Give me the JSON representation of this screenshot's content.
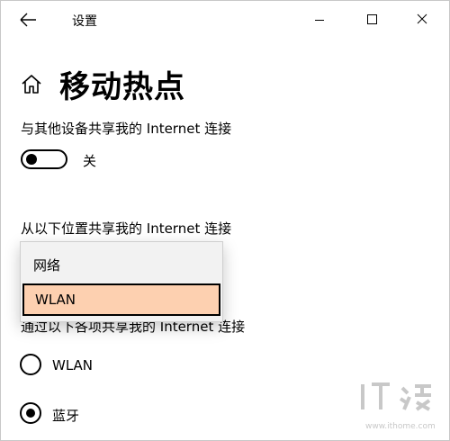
{
  "window": {
    "title": "设置"
  },
  "page": {
    "title": "移动热点"
  },
  "share_section": {
    "label": "与其他设备共享我的 Internet 连接",
    "toggle_state": "off",
    "toggle_label": "关"
  },
  "source_section": {
    "label": "从以下位置共享我的 Internet 连接",
    "dropdown_options": [
      "网络",
      "WLAN"
    ],
    "selected": "WLAN"
  },
  "via_section": {
    "label": "通过以下各项共享我的 Internet 连接",
    "options": [
      {
        "label": "WLAN",
        "checked": false
      },
      {
        "label": "蓝牙",
        "checked": true
      }
    ]
  },
  "watermark": {
    "text": "www.ithome.com",
    "logo": "ithome-logo"
  },
  "icons": {
    "back": "back-arrow-icon",
    "minimize": "minimize-icon",
    "maximize": "maximize-icon",
    "close": "close-icon",
    "home": "home-icon"
  },
  "colors": {
    "selected_item_bg": "#fdd0b0",
    "dropdown_bg": "#f2f2f2",
    "watermark": "#c8c8c8"
  }
}
